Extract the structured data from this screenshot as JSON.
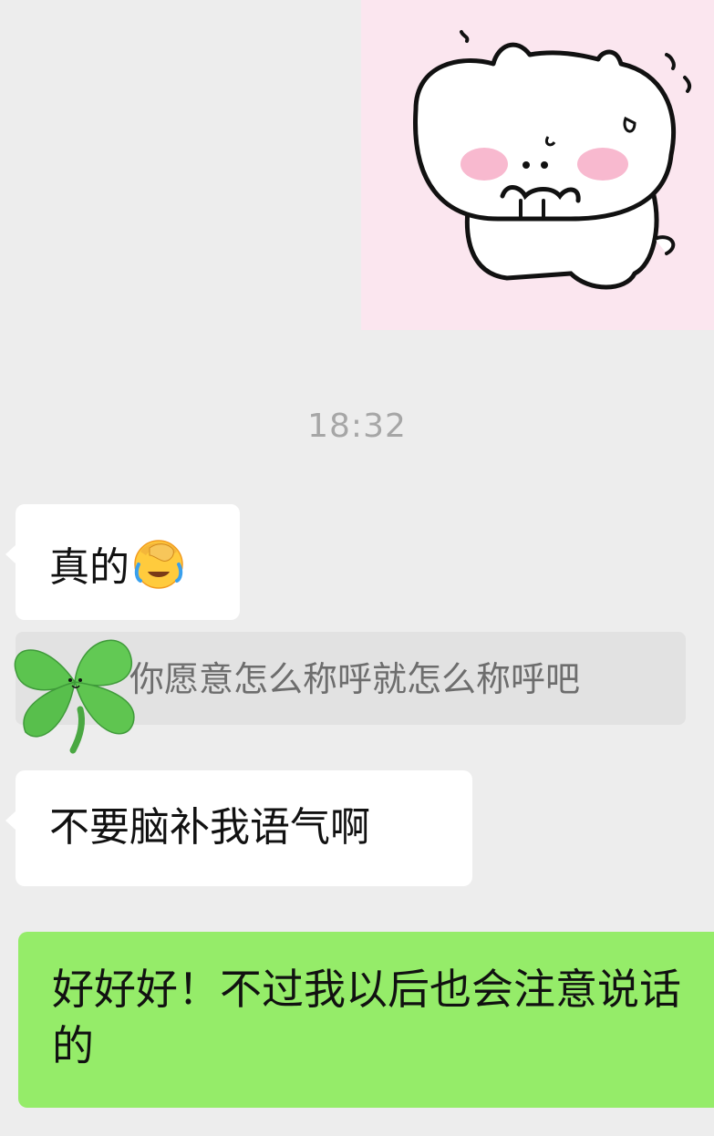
{
  "messages": {
    "sticker_name": "cat-sticker",
    "timestamp": "18:32",
    "incoming_1": "真的",
    "incoming_1_emoji": "face-palm-tears-emoji",
    "quote": "你愿意怎么称呼就怎么称呼吧",
    "quote_decoration": "clover-icon",
    "incoming_2": "不要脑补我语气啊",
    "outgoing_1": "好好好！不过我以后也会注意说话的"
  },
  "colors": {
    "background": "#ededed",
    "incoming_bubble": "#ffffff",
    "outgoing_bubble": "#95ec69",
    "quote_bg": "#e2e2e2",
    "sticker_bg": "#fbe6ef"
  }
}
